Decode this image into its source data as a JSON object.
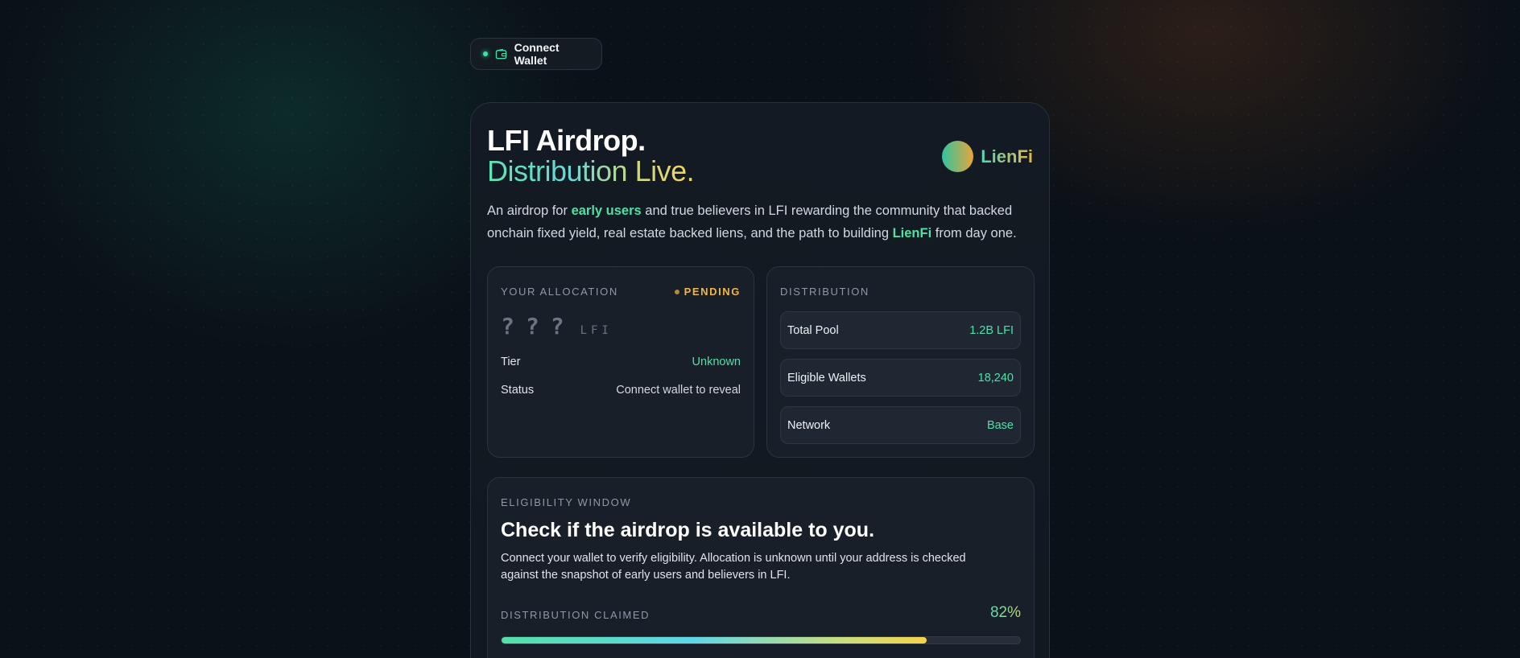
{
  "header": {
    "connect_wallet_label": "Connect Wallet"
  },
  "hero": {
    "title_line1": "LFI Airdrop.",
    "title_line2": "Distribution Live.",
    "brand_name": "LienFi",
    "intro_part1": "An airdrop for ",
    "intro_highlight1": "early users",
    "intro_part2": " and true believers in LFI rewarding the community that backed onchain fixed yield, real estate backed liens, and the path to building ",
    "intro_highlight2": "LienFi",
    "intro_part3": " from day one."
  },
  "allocation": {
    "label": "YOUR ALLOCATION",
    "status_badge": "PENDING",
    "amount": "???",
    "unit": "LFI",
    "rows": [
      {
        "key": "Tier",
        "value": "Unknown"
      },
      {
        "key": "Status",
        "value": "Connect wallet to reveal"
      }
    ]
  },
  "distribution": {
    "label": "DISTRIBUTION",
    "stats": [
      {
        "key": "Total Pool",
        "value": "1.2B LFI"
      },
      {
        "key": "Eligible Wallets",
        "value": "18,240"
      },
      {
        "key": "Network",
        "value": "Base"
      }
    ]
  },
  "eligibility": {
    "label": "ELIGIBILITY WINDOW",
    "title": "Check if the airdrop is available to you.",
    "description": "Connect your wallet to verify eligibility. Allocation is unknown until your address is checked against the snapshot of early users and believers in LFI.",
    "claimed_label": "DISTRIBUTION CLAIMED",
    "claimed_percent_text": "82%",
    "claimed_fraction": 0.82
  },
  "colors": {
    "accent_green": "#4fe0a6",
    "pending_amber": "#f0b63e",
    "background": "#0b1118"
  },
  "icons": {
    "wallet": "wallet-icon",
    "status_dot": "status-dot-icon"
  }
}
